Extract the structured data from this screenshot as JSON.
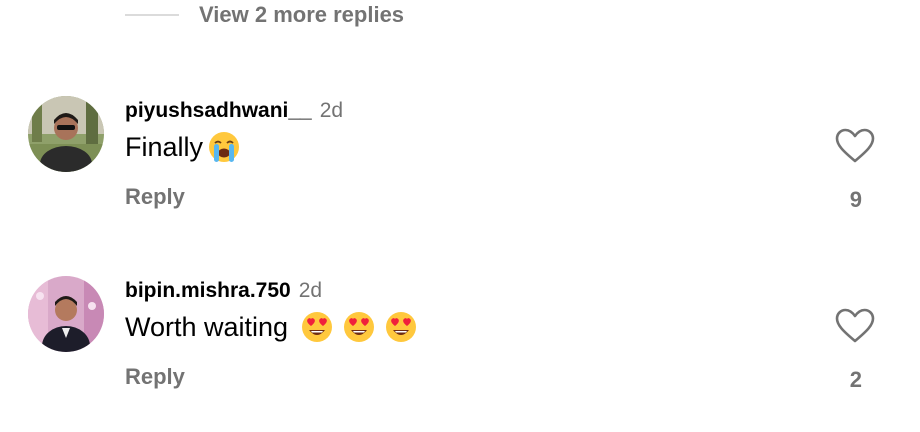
{
  "thread": {
    "view_more_label": "View 2 more replies"
  },
  "comments": [
    {
      "username": "piyushsadhwani__",
      "time": "2d",
      "text": "Finally",
      "emojis": [
        "loudly-crying-face-emoji"
      ],
      "reply_label": "Reply",
      "like_count": "9"
    },
    {
      "username": "bipin.mishra.750",
      "time": "2d",
      "text": "Worth waiting",
      "emojis": [
        "heart-eyes-emoji",
        "heart-eyes-emoji",
        "heart-eyes-emoji"
      ],
      "reply_label": "Reply",
      "like_count": "2"
    }
  ],
  "icons": {
    "like": "heart-outline-icon"
  },
  "colors": {
    "secondary_text": "#737373",
    "primary_text": "#000000",
    "divider": "#dbdbdb",
    "emoji_yellow": "#ffc83d",
    "emoji_heart": "#f0203c"
  }
}
